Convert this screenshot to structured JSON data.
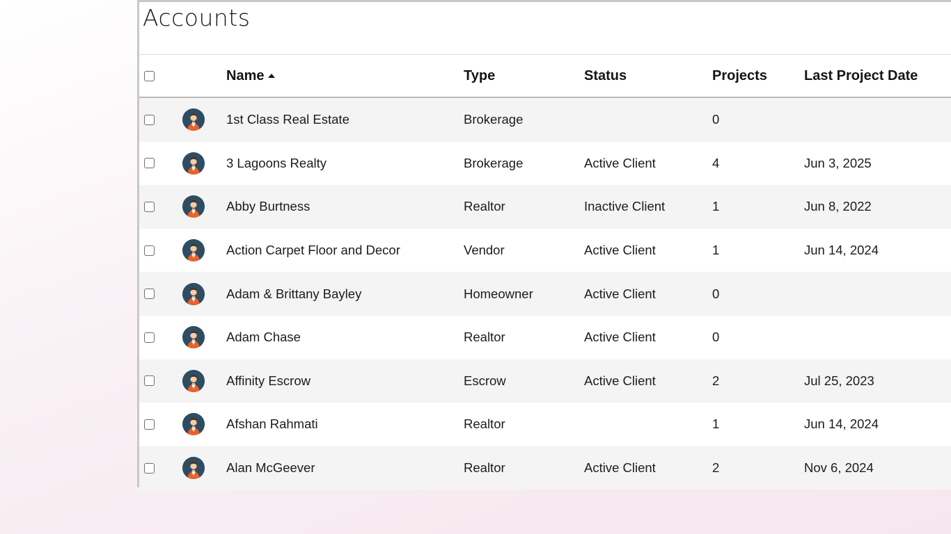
{
  "page": {
    "title": "Accounts"
  },
  "columns": {
    "name": "Name",
    "type": "Type",
    "status": "Status",
    "projects": "Projects",
    "last_project_date": "Last Project Date"
  },
  "sort": {
    "column": "Name",
    "direction": "ascending"
  },
  "rows": [
    {
      "name": "1st Class Real Estate",
      "type": "Brokerage",
      "status": "",
      "projects": "0",
      "last_project_date": ""
    },
    {
      "name": "3 Lagoons Realty",
      "type": "Brokerage",
      "status": "Active Client",
      "projects": "4",
      "last_project_date": "Jun 3, 2025"
    },
    {
      "name": "Abby Burtness",
      "type": "Realtor",
      "status": "Inactive Client",
      "projects": "1",
      "last_project_date": "Jun 8, 2022"
    },
    {
      "name": "Action Carpet Floor and Decor",
      "type": "Vendor",
      "status": "Active Client",
      "projects": "1",
      "last_project_date": "Jun 14, 2024"
    },
    {
      "name": "Adam & Brittany Bayley",
      "type": "Homeowner",
      "status": "Active Client",
      "projects": "0",
      "last_project_date": ""
    },
    {
      "name": "Adam Chase",
      "type": "Realtor",
      "status": "Active Client",
      "projects": "0",
      "last_project_date": ""
    },
    {
      "name": "Affinity Escrow",
      "type": "Escrow",
      "status": "Active Client",
      "projects": "2",
      "last_project_date": "Jul 25, 2023"
    },
    {
      "name": "Afshan Rahmati",
      "type": "Realtor",
      "status": "",
      "projects": "1",
      "last_project_date": "Jun 14, 2024"
    },
    {
      "name": "Alan McGeever",
      "type": "Realtor",
      "status": "Active Client",
      "projects": "2",
      "last_project_date": "Nov 6, 2024"
    }
  ],
  "icons": {
    "avatar": "person-avatar-icon",
    "sort": "sort-ascending-icon",
    "checkbox": "checkbox-icon"
  },
  "colors": {
    "avatar_bg": "#2e4d62",
    "avatar_shirt": "#e8632b",
    "row_stripe": "#f4f4f4"
  }
}
